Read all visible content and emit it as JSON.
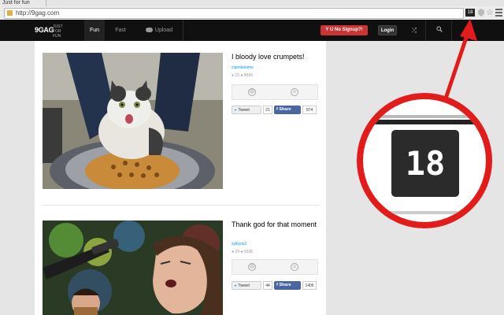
{
  "browser": {
    "tab_title": "Just for fun",
    "url": "http://9gag.com",
    "extension_badge": "18"
  },
  "nav": {
    "logo": "9GAG",
    "tagline": "JUST FOR FUN",
    "tabs": [
      "Fun",
      "Fast",
      "Upload"
    ],
    "active_tab": "Fun",
    "signup_label": "Y U No Signup?!",
    "login_label": "Login"
  },
  "posts": [
    {
      "title": "I bloody love crumpets!",
      "user": "claimbelame",
      "comments": "15",
      "points": "8699",
      "tweet_label": "Tweet",
      "tweet_count": "21",
      "share_label": "Share",
      "share_count": "974"
    },
    {
      "title": "Thank god for that moment",
      "user": "sylkyos2",
      "comments": "29",
      "points": "5538",
      "tweet_label": "Tweet",
      "tweet_count": "44",
      "share_label": "Share",
      "share_count": "1405"
    }
  ],
  "callout": {
    "badge_text": "18",
    "color": "#e21b1b"
  }
}
